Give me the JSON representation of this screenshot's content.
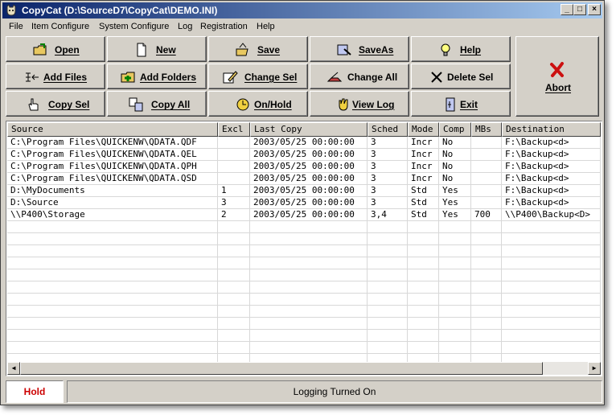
{
  "window": {
    "title": "CopyCat  (D:\\SourceD7\\CopyCat\\DEMO.INI)",
    "controls": {
      "minimize": "_",
      "maximize": "□",
      "close": "×"
    }
  },
  "menu": [
    "File",
    "Item Configure",
    "System Configure",
    "Log",
    "Registration",
    "Help"
  ],
  "toolbar": {
    "buttons": [
      {
        "label": "Open",
        "icon": "open-folder-icon"
      },
      {
        "label": "New",
        "icon": "new-document-icon"
      },
      {
        "label": "Save",
        "icon": "save-icon"
      },
      {
        "label": "SaveAs",
        "icon": "save-as-icon"
      },
      {
        "label": "Help",
        "icon": "help-lightbulb-icon"
      },
      {
        "label": "Add Files",
        "icon": "add-files-icon"
      },
      {
        "label": "Add Folders",
        "icon": "add-folders-icon"
      },
      {
        "label": "Change Sel",
        "icon": "edit-pencil-icon"
      },
      {
        "label": "Change All",
        "icon": "change-all-icon"
      },
      {
        "label": "Delete Sel",
        "icon": "delete-x-icon"
      },
      {
        "label": "Copy Sel",
        "icon": "hand-pointer-icon"
      },
      {
        "label": "Copy All",
        "icon": "copy-all-icon"
      },
      {
        "label": "On/Hold",
        "icon": "clock-icon"
      },
      {
        "label": "View Log",
        "icon": "view-log-hand-icon"
      },
      {
        "label": "Exit",
        "icon": "exit-door-icon"
      }
    ],
    "abort_label": "Abort"
  },
  "grid": {
    "columns": [
      "Source",
      "Excl",
      "Last Copy",
      "Sched",
      "Mode",
      "Comp",
      "MBs",
      "Destination"
    ],
    "rows": [
      [
        "C:\\Program Files\\QUICKENW\\QDATA.QDF",
        "",
        "2003/05/25 00:00:00",
        "3",
        "Incr",
        "No",
        "",
        "F:\\Backup<d>"
      ],
      [
        "C:\\Program Files\\QUICKENW\\QDATA.QEL",
        "",
        "2003/05/25 00:00:00",
        "3",
        "Incr",
        "No",
        "",
        "F:\\Backup<d>"
      ],
      [
        "C:\\Program Files\\QUICKENW\\QDATA.QPH",
        "",
        "2003/05/25 00:00:00",
        "3",
        "Incr",
        "No",
        "",
        "F:\\Backup<d>"
      ],
      [
        "C:\\Program Files\\QUICKENW\\QDATA.QSD",
        "",
        "2003/05/25 00:00:00",
        "3",
        "Incr",
        "No",
        "",
        "F:\\Backup<d>"
      ],
      [
        "D:\\MyDocuments",
        "1",
        "2003/05/25 00:00:00",
        "3",
        "Std",
        "Yes",
        "",
        "F:\\Backup<d>"
      ],
      [
        "D:\\Source",
        "3",
        "2003/05/25 00:00:00",
        "3",
        "Std",
        "Yes",
        "",
        "F:\\Backup<d>"
      ],
      [
        "\\\\P400\\Storage",
        "2",
        "2003/05/25 00:00:00",
        "3,4",
        "Std",
        "Yes",
        "700",
        "\\\\P400\\Backup<D>"
      ]
    ]
  },
  "status": {
    "hold": "Hold",
    "message": "Logging Turned On",
    "hold_color": "#cc0000"
  },
  "colors": {
    "titlebar_start": "#0a246a",
    "titlebar_end": "#a6caf0",
    "face": "#d4d0c8",
    "abort_icon": "#cc1010"
  }
}
